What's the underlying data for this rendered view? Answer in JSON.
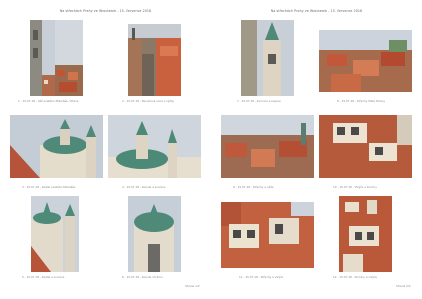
{
  "left_page": {
    "title": "Na střechách Prahy ve Wrocławie - 15. července 2018",
    "page_number": "Strana 1/2",
    "captions": [
      "1 - 15.07.18 - Věž svatého Mikuláše, Vltava",
      "2 - 15.07.18 - Nerudova ulice z výšky",
      "3 - 15.07.18 - Kostel svatého Mikuláše",
      "4 - 15.07.18 - Kopule a zvonice",
      "5 - 15.07.18 - Kostel a zvonice",
      "6 - 15.07.18 - Kopule chrámu"
    ]
  },
  "right_page": {
    "title": "Na střechách Prahy ve Wrocławie - 15. července 2018",
    "page_number": "Strana 2/2",
    "captions": [
      "7 - 15.07.18 - Zvonice a kopule",
      "8 - 15.07.18 - Střechy Malé Strany",
      "9 - 15.07.18 - Střechy a věže",
      "10 - 15.07.18 - Vikýře a komíny",
      "11 - 15.07.18 - Střechy a vikýře",
      "12 - 15.07.18 - Komíny a vikýře"
    ]
  }
}
